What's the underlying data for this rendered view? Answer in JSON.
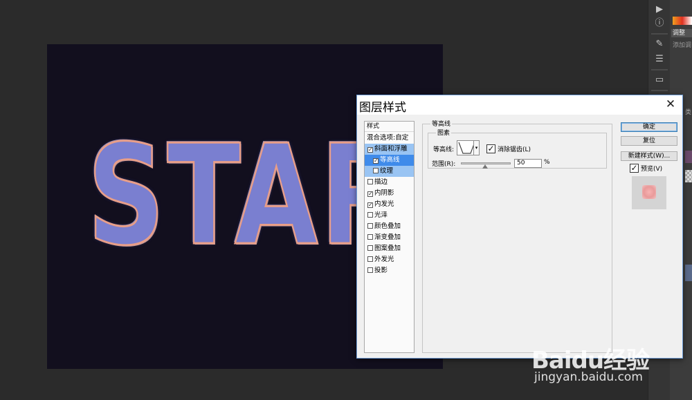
{
  "canvas": {
    "text": "STAR"
  },
  "dialog": {
    "title": "图层样式",
    "close_label": "✕",
    "styles_header": "样式",
    "styles": [
      {
        "label": "混合选项:自定",
        "checkbox": false,
        "checked": false,
        "state": ""
      },
      {
        "label": "斜面和浮雕",
        "checkbox": true,
        "checked": true,
        "state": "sel"
      },
      {
        "label": "等高线",
        "checkbox": true,
        "checked": true,
        "state": "sel2",
        "sub": true
      },
      {
        "label": "纹理",
        "checkbox": true,
        "checked": false,
        "state": "sel",
        "sub": true
      },
      {
        "label": "描边",
        "checkbox": true,
        "checked": false,
        "state": ""
      },
      {
        "label": "内阴影",
        "checkbox": true,
        "checked": true,
        "state": ""
      },
      {
        "label": "内发光",
        "checkbox": true,
        "checked": true,
        "state": ""
      },
      {
        "label": "光泽",
        "checkbox": true,
        "checked": false,
        "state": ""
      },
      {
        "label": "颜色叠加",
        "checkbox": true,
        "checked": false,
        "state": ""
      },
      {
        "label": "渐变叠加",
        "checkbox": true,
        "checked": false,
        "state": ""
      },
      {
        "label": "图案叠加",
        "checkbox": true,
        "checked": false,
        "state": ""
      },
      {
        "label": "外发光",
        "checkbox": true,
        "checked": false,
        "state": ""
      },
      {
        "label": "投影",
        "checkbox": true,
        "checked": false,
        "state": ""
      }
    ],
    "contour_group": {
      "title": "等高线",
      "subgroup_title": "图素",
      "contour_label": "等高线:",
      "antialias_label": "消除锯齿(L)",
      "antialias_checked": "✓",
      "range_label": "范围(R):",
      "range_value": "50",
      "range_unit": "%"
    },
    "buttons": {
      "ok": "确定",
      "reset": "复位",
      "new_style": "新建样式(W)...",
      "preview_label": "预览(V)",
      "preview_checked": "✓"
    }
  },
  "right_panel": {
    "tab": "调整",
    "subtitle": "添加调",
    "mini_label": "类"
  },
  "watermark": {
    "brand": "Baidu经验",
    "url": "jingyan.baidu.com"
  },
  "colors": {
    "dialog_bg": "#f0f0f0",
    "selection": "#3f8bea",
    "selection_light": "#99c4f3",
    "canvas_bg": "#120f1e",
    "app_bg": "#2b2b2b"
  }
}
